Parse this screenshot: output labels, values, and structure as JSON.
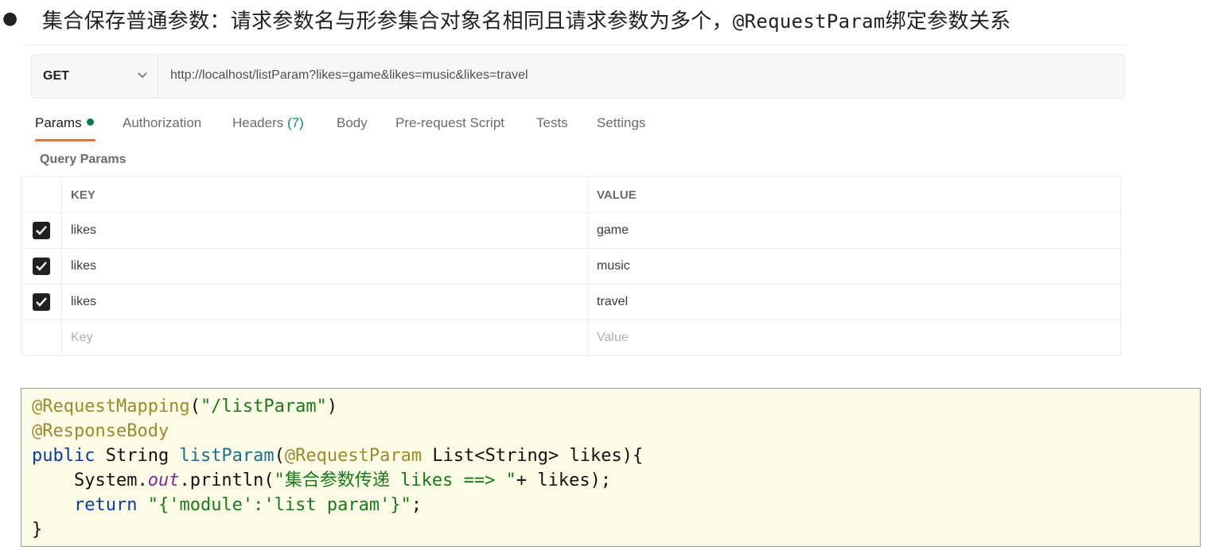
{
  "headline": {
    "bullet": "●",
    "text_cn": "集合保存普通参数：请求参数名与形参集合对象名相同且请求参数为多个，",
    "text_mono": "@RequestParam",
    "text_tail": "绑定参数关系"
  },
  "request": {
    "method": "GET",
    "url": "http://localhost/listParam?likes=game&likes=music&likes=travel"
  },
  "tabs": [
    {
      "label": "Params",
      "active": true
    },
    {
      "label": "Authorization"
    },
    {
      "label": "Headers",
      "count": "(7)"
    },
    {
      "label": "Body"
    },
    {
      "label": "Pre-request Script"
    },
    {
      "label": "Tests"
    },
    {
      "label": "Settings"
    }
  ],
  "query_params": {
    "label": "Query Params",
    "columns": [
      "KEY",
      "VALUE"
    ],
    "rows": [
      {
        "key": "likes",
        "value": "game",
        "checked": true
      },
      {
        "key": "likes",
        "value": "music",
        "checked": true
      },
      {
        "key": "likes",
        "value": "travel",
        "checked": true
      }
    ],
    "placeholder_key": "Key",
    "placeholder_value": "Value"
  },
  "code": {
    "line1_ann": "@RequestMapping",
    "line1_rest_open": "(",
    "line1_str": "\"/listParam\"",
    "line1_close": ")",
    "line2_ann": "@ResponseBody",
    "line3_kw": "public",
    "line3_type": " String ",
    "line3_fn": "listParam",
    "line3_open": "(",
    "line3_ann": "@RequestParam",
    "line3_rest": " List<String> likes){",
    "line4_indent": "    ",
    "line4_sys": "System.",
    "line4_field": "out",
    "line4_println": ".println(",
    "line4_str": "\"集合参数传递 likes ==> \"",
    "line4_rest": "+ likes);",
    "line5_indent": "    ",
    "line5_kw": "return",
    "line5_space": " ",
    "line5_str": "\"{'module':'list param'}\"",
    "line5_semi": ";",
    "line6": "}"
  },
  "colors": {
    "accent_tab": "#f26b3a",
    "params_dot": "#0c7a4a",
    "headers_count": "#0a8f5a",
    "code_bg": "#fcfce6"
  }
}
